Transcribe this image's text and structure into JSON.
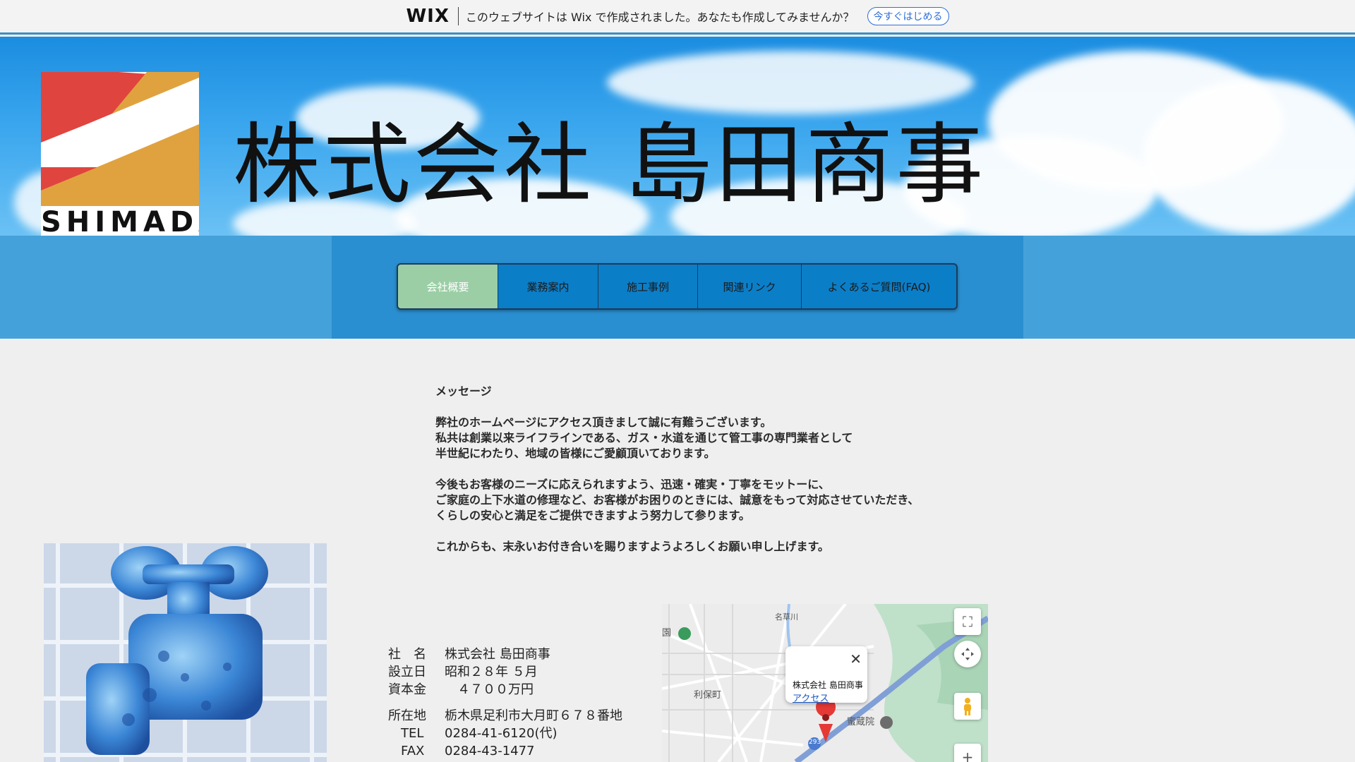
{
  "wix_banner": {
    "logo": "WIX",
    "text": "このウェブサイトは Wix で作成されました。あなたも作成してみませんか？",
    "cta": "今すぐはじめる"
  },
  "header": {
    "logo_text": "SHIMADA",
    "company_title": "株式会社 島田商事"
  },
  "nav": {
    "items": [
      {
        "label": "会社概要",
        "active": true
      },
      {
        "label": "業務案内",
        "active": false
      },
      {
        "label": "施工事例",
        "active": false
      },
      {
        "label": "関連リンク",
        "active": false
      },
      {
        "label": "よくあるご質問(FAQ)",
        "active": false
      }
    ]
  },
  "message": {
    "title": "メッセージ",
    "paragraphs": [
      [
        "弊社のホームページにアクセス頂きまして誠に有難うございます。",
        "私共は創業以来ライフラインである、ガス・水道を通じて管工事の専門業者として",
        "半世紀にわたり、地域の皆様にご愛顧頂いております。"
      ],
      [
        "今後もお客様のニーズに応えられますよう、迅速・確実・丁寧をモットーに、",
        "ご家庭の上下水道の修理など、お客様がお困りのときには、誠意をもって対応させていただき、",
        "くらしの安心と満足をご提供できますよう努力して参ります。"
      ],
      [
        "これからも、末永いお付き合いを賜りますようよろしくお願い申し上げます。"
      ]
    ]
  },
  "company_info": {
    "rows": [
      {
        "label": "社　名",
        "value": "株式会社 島田商事"
      },
      {
        "label": "設立日",
        "value": "昭和２８年 ５月"
      },
      {
        "label": "資本金",
        "value": "　４７００万円"
      }
    ],
    "rows2": [
      {
        "label": "所在地",
        "value": "栃木県足利市大月町６７８番地"
      },
      {
        "label": "　TEL",
        "value": "0284-41-6120(代)"
      },
      {
        "label": "　FAX",
        "value": "0284-43-1477"
      }
    ]
  },
  "map": {
    "place_name": "株式会社 島田商事",
    "access_link": "アクセス",
    "close": "✕",
    "labels": {
      "park": "園",
      "town": "利保町",
      "temple": "蜜蔵院",
      "river": "名草川",
      "road": "293"
    },
    "controls": {
      "fullscreen": "⛶",
      "zoom_in": "+"
    }
  },
  "colors": {
    "accent": "#2a8fd0",
    "nav_active": "#9ccea6",
    "logo_red": "#e0443f",
    "logo_orange": "#e0a23f"
  }
}
